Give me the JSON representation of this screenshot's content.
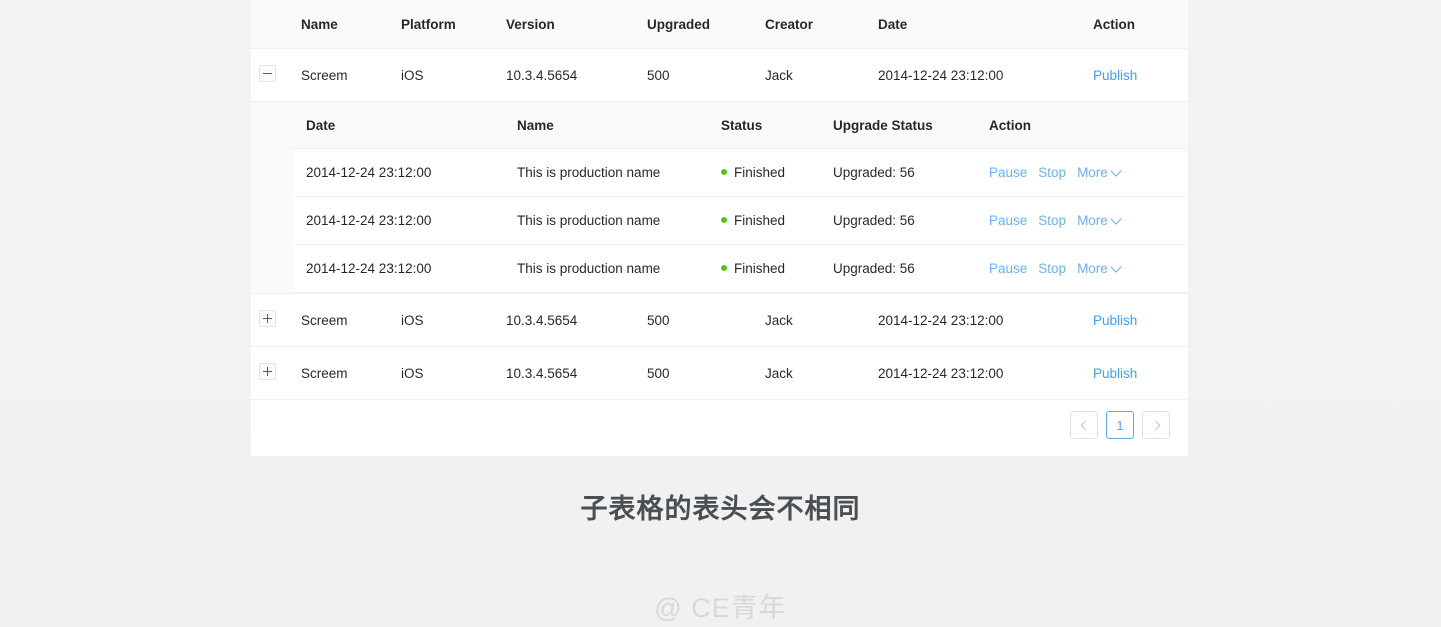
{
  "caption": "子表格的表头会不相同",
  "watermark": "@ CE青年",
  "colors": {
    "link": "#6cb2f2",
    "publish_link": "#40a0f5",
    "status_finished": "#52c41a",
    "pagination_active": "#5aaaf0",
    "header_bg": "#fafafa",
    "card_bg": "#ffffff",
    "page_bg": "#f1f1f1"
  },
  "main_table": {
    "columns": [
      "Name",
      "Platform",
      "Version",
      "Upgraded",
      "Creator",
      "Date",
      "Action"
    ],
    "rows": [
      {
        "expand_state": "expanded",
        "expand_icon": "minus-square-icon",
        "name": "Screem",
        "platform": "iOS",
        "version": "10.3.4.5654",
        "upgraded": "500",
        "creator": "Jack",
        "date": "2014-12-24 23:12:00",
        "action": "Publish"
      },
      {
        "expand_state": "collapsed",
        "expand_icon": "plus-square-icon",
        "name": "Screem",
        "platform": "iOS",
        "version": "10.3.4.5654",
        "upgraded": "500",
        "creator": "Jack",
        "date": "2014-12-24 23:12:00",
        "action": "Publish"
      },
      {
        "expand_state": "collapsed",
        "expand_icon": "plus-square-icon",
        "name": "Screem",
        "platform": "iOS",
        "version": "10.3.4.5654",
        "upgraded": "500",
        "creator": "Jack",
        "date": "2014-12-24 23:12:00",
        "action": "Publish"
      }
    ]
  },
  "sub_table": {
    "columns": [
      "Date",
      "Name",
      "Status",
      "Upgrade Status",
      "Action"
    ],
    "rows": [
      {
        "date": "2014-12-24 23:12:00",
        "name": "This is production name",
        "status": "Finished",
        "upgrade_status": "Upgraded: 56",
        "actions": {
          "pause": "Pause",
          "stop": "Stop",
          "more": "More"
        }
      },
      {
        "date": "2014-12-24 23:12:00",
        "name": "This is production name",
        "status": "Finished",
        "upgrade_status": "Upgraded: 56",
        "actions": {
          "pause": "Pause",
          "stop": "Stop",
          "more": "More"
        }
      },
      {
        "date": "2014-12-24 23:12:00",
        "name": "This is production name",
        "status": "Finished",
        "upgrade_status": "Upgraded: 56",
        "actions": {
          "pause": "Pause",
          "stop": "Stop",
          "more": "More"
        }
      }
    ]
  },
  "pagination": {
    "prev_icon": "chevron-left-icon",
    "next_icon": "chevron-right-icon",
    "pages": [
      "1"
    ],
    "current": "1"
  }
}
